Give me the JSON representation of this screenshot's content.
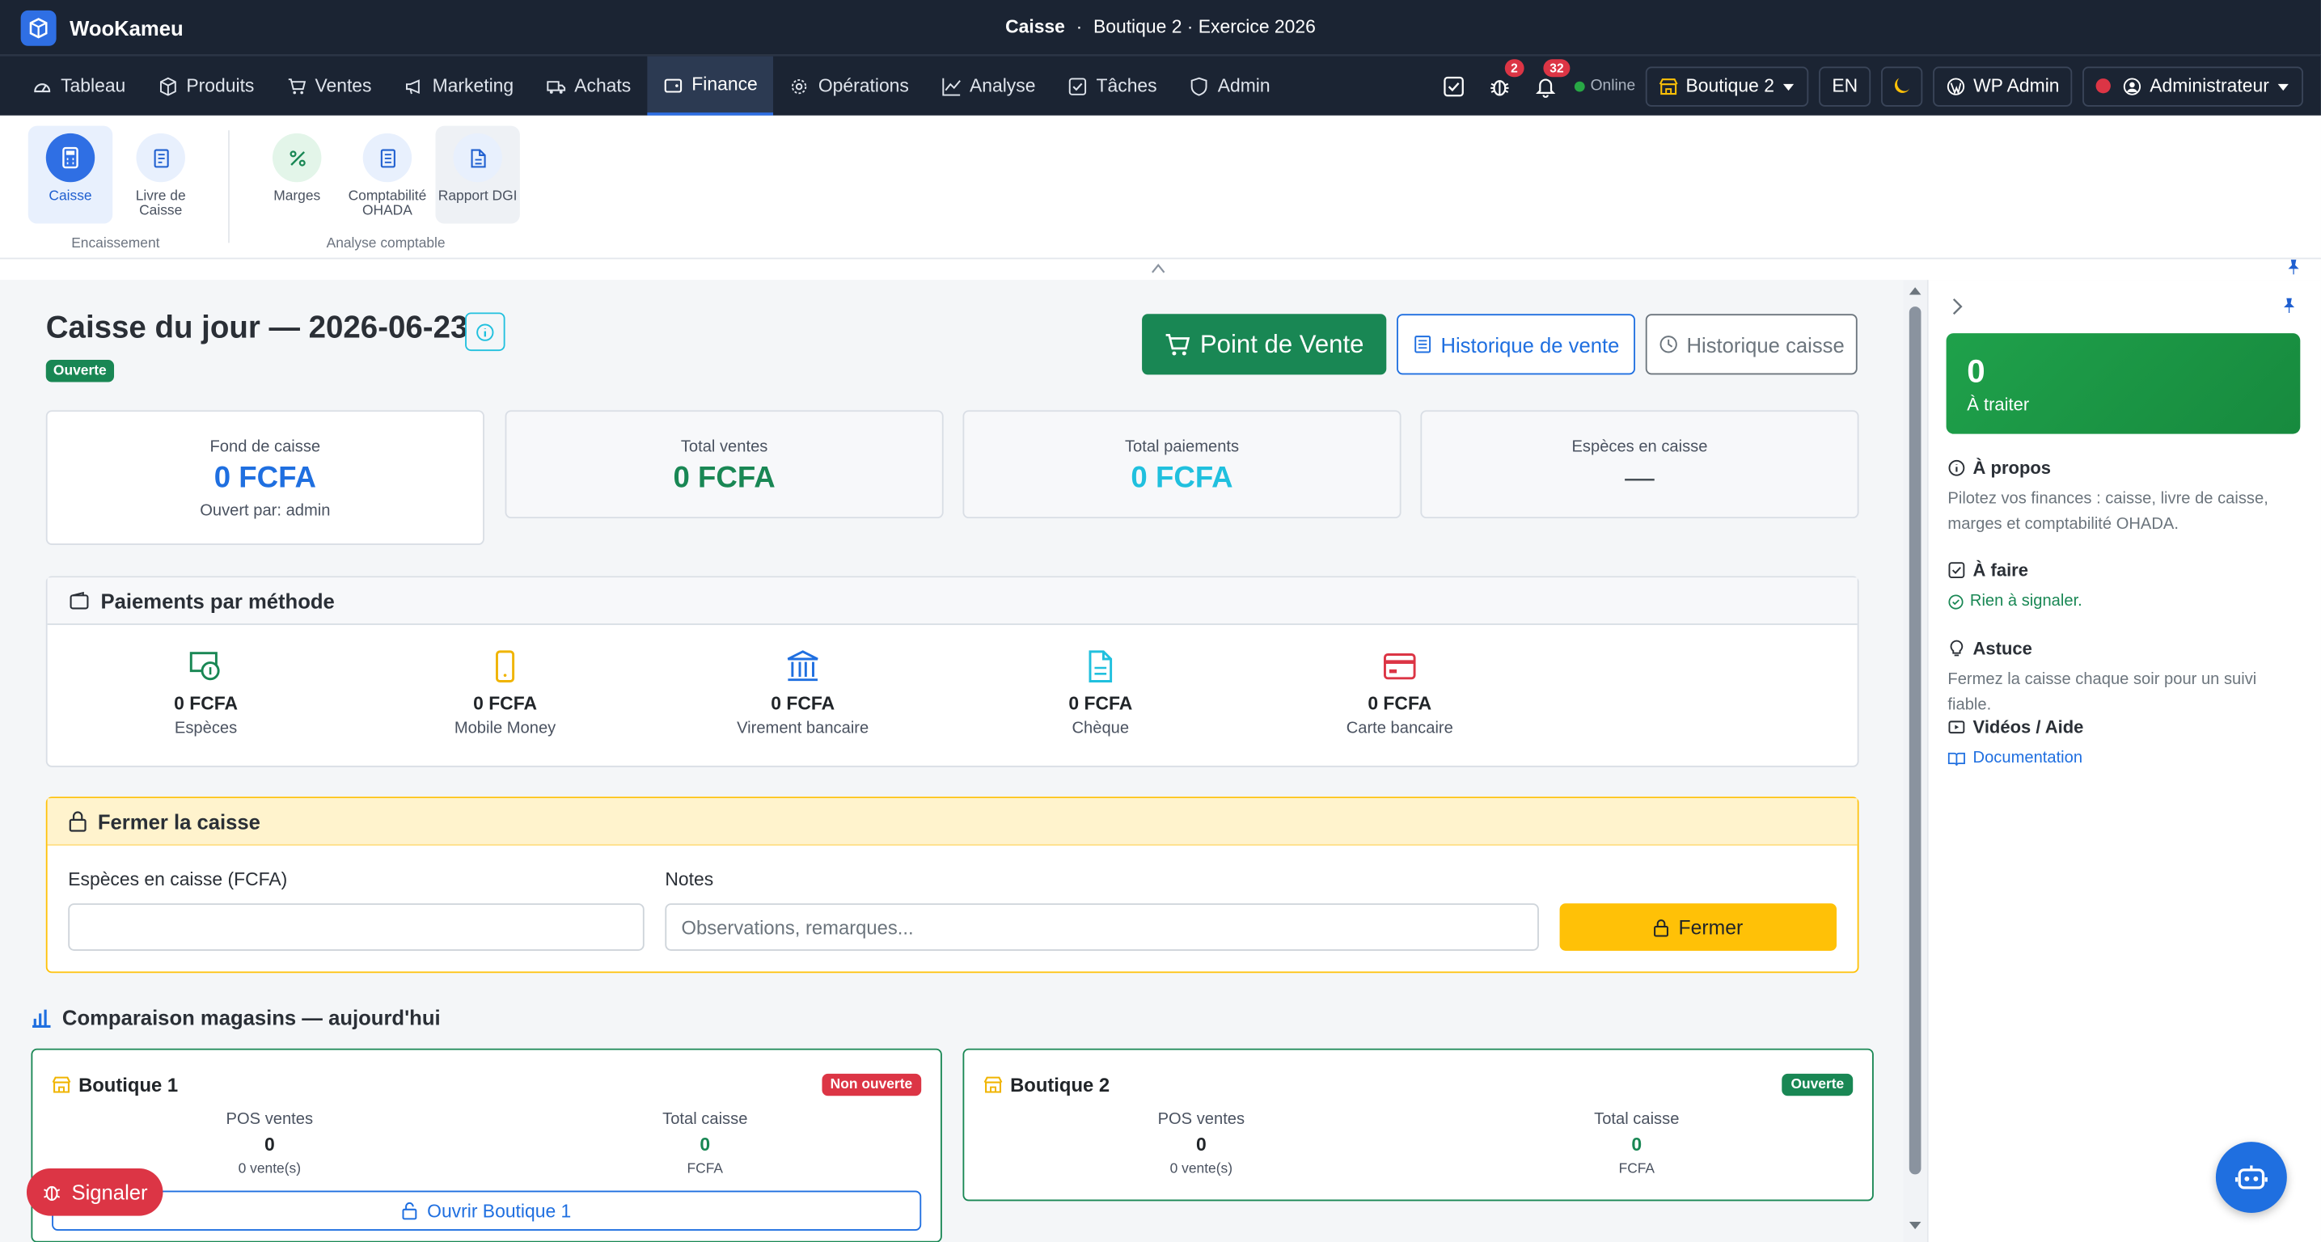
{
  "app": {
    "name": "WooKameu"
  },
  "window_title": {
    "page": "Caisse",
    "separator": "·",
    "context": "Boutique 2 · Exercice 2026"
  },
  "nav": {
    "items": [
      {
        "label": "Tableau",
        "icon": "dashboard-icon"
      },
      {
        "label": "Produits",
        "icon": "box-icon"
      },
      {
        "label": "Ventes",
        "icon": "cart-icon"
      },
      {
        "label": "Marketing",
        "icon": "megaphone-icon"
      },
      {
        "label": "Achats",
        "icon": "truck-icon"
      },
      {
        "label": "Finance",
        "icon": "wallet-icon",
        "active": true
      },
      {
        "label": "Opérations",
        "icon": "gear-icon"
      },
      {
        "label": "Analyse",
        "icon": "chart-line-icon"
      },
      {
        "label": "Tâches",
        "icon": "checkbox-icon"
      },
      {
        "label": "Admin",
        "icon": "shield-icon"
      }
    ],
    "right": {
      "bug_count": "2",
      "notif_count": "32",
      "online_label": "Online",
      "shop": "Boutique 2",
      "lang": "EN",
      "wp_admin": "WP Admin",
      "user": "Administrateur"
    }
  },
  "ribbon": {
    "groups": [
      {
        "label": "Encaissement",
        "items": [
          {
            "label": "Caisse",
            "icon": "calculator-icon",
            "selected": true
          },
          {
            "label": "Livre de Caisse",
            "icon": "ledger-icon"
          }
        ]
      },
      {
        "label": "Analyse comptable",
        "items": [
          {
            "label": "Marges",
            "icon": "percent-icon"
          },
          {
            "label": "Comptabilité OHADA",
            "icon": "accounting-icon"
          },
          {
            "label": "Rapport DGI",
            "icon": "report-icon"
          }
        ]
      }
    ]
  },
  "page": {
    "title": "Caisse du jour — 2026-06-23",
    "status": "Ouverte",
    "buttons": {
      "pos": "Point de Vente",
      "sales_history": "Historique de vente",
      "cash_history": "Historique caisse"
    },
    "stats": [
      {
        "label": "Fond de caisse",
        "value": "0 FCFA",
        "sub": "Ouvert par: admin",
        "color": "#1f6fe0"
      },
      {
        "label": "Total ventes",
        "value": "0 FCFA",
        "color": "#198754"
      },
      {
        "label": "Total paiements",
        "value": "0 FCFA",
        "color": "#20c0de"
      },
      {
        "label": "Espèces en caisse",
        "value": "—",
        "color": "#495057"
      }
    ],
    "payments": {
      "title": "Paiements par méthode",
      "methods": [
        {
          "label": "Espèces",
          "value": "0 FCFA",
          "icon": "cash-icon",
          "color": "#198754"
        },
        {
          "label": "Mobile Money",
          "value": "0 FCFA",
          "icon": "phone-icon",
          "color": "#f0b400"
        },
        {
          "label": "Virement bancaire",
          "value": "0 FCFA",
          "icon": "bank-icon",
          "color": "#1f6fe0"
        },
        {
          "label": "Chèque",
          "value": "0 FCFA",
          "icon": "document-icon",
          "color": "#20c0de"
        },
        {
          "label": "Carte bancaire",
          "value": "0 FCFA",
          "icon": "credit-card-icon",
          "color": "#dc3545"
        }
      ]
    },
    "close": {
      "title": "Fermer la caisse",
      "cash_label": "Espèces en caisse (FCFA)",
      "cash_value": "",
      "notes_label": "Notes",
      "notes_placeholder": "Observations, remarques...",
      "button": "Fermer"
    },
    "compare": {
      "title": "Comparaison magasins — aujourd'hui",
      "shops": [
        {
          "name": "Boutique 1",
          "status": "Non ouverte",
          "status_color": "#dc3545",
          "pos_label": "POS ventes",
          "pos_value": "0",
          "pos_sub": "0 vente(s)",
          "total_label": "Total caisse",
          "total_value": "0",
          "total_sub": "FCFA",
          "open_button": "Ouvrir Boutique 1"
        },
        {
          "name": "Boutique 2",
          "status": "Ouverte",
          "status_color": "#198754",
          "pos_label": "POS ventes",
          "pos_value": "0",
          "pos_sub": "0 vente(s)",
          "total_label": "Total caisse",
          "total_value": "0",
          "total_sub": "FCFA"
        }
      ]
    }
  },
  "report_button": "Signaler",
  "sidebar": {
    "todo_count": "0",
    "todo_label": "À traiter",
    "about_title": "À propos",
    "about_text": "Pilotez vos finances : caisse, livre de caisse, marges et comptabilité OHADA.",
    "todo_title": "À faire",
    "todo_text": "Rien à signaler.",
    "tip_title": "Astuce",
    "tip_text": "Fermez la caisse chaque soir pour un suivi fiable.",
    "videos_title": "Vidéos / Aide",
    "doc_link": "Documentation"
  }
}
